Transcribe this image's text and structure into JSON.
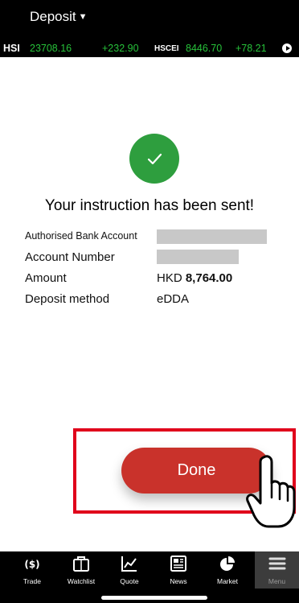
{
  "header": {
    "title": "Deposit",
    "caret": "▼"
  },
  "ticker": {
    "hsi_label": "HSI",
    "hsi_value": "23708.16",
    "hsi_change": "+232.90",
    "hscei_label": "HSCEI",
    "hscei_value": "8446.70",
    "hscei_change": "+78.21",
    "play_icon": "play-circle-icon"
  },
  "confirmation": {
    "icon": "check-circle-icon",
    "message": "Your instruction has been sent!",
    "details": [
      {
        "label": "Authorised Bank Account",
        "value": "",
        "masked": true
      },
      {
        "label": "Account Number",
        "value": "",
        "masked": true
      },
      {
        "label": "Amount",
        "currency": "HKD",
        "value": "8,764.00"
      },
      {
        "label": "Deposit method",
        "value": "eDDA"
      }
    ]
  },
  "actions": {
    "done_label": "Done"
  },
  "annotation": {
    "highlight_color": "#e0001b",
    "pointer_icon": "hand-pointer-icon"
  },
  "tabbar": {
    "tabs": [
      {
        "label": "Trade",
        "icon": "dollar-icon"
      },
      {
        "label": "Watchlist",
        "icon": "briefcase-icon"
      },
      {
        "label": "Quote",
        "icon": "line-chart-icon"
      },
      {
        "label": "News",
        "icon": "newspaper-icon"
      },
      {
        "label": "Market",
        "icon": "pie-chart-icon"
      },
      {
        "label": "Menu",
        "icon": "hamburger-icon",
        "active": true
      }
    ]
  },
  "colors": {
    "accent": "#c9322b",
    "success": "#2e9e3e",
    "ticker_up": "#27c23a"
  }
}
